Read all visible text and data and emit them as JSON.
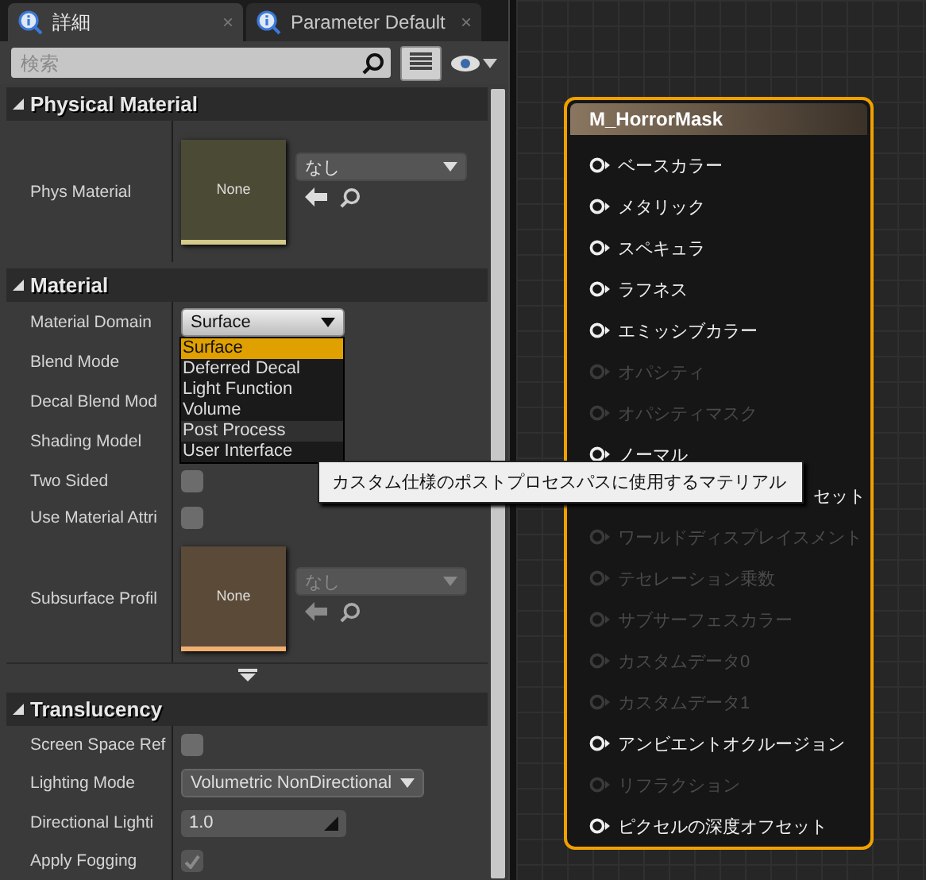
{
  "tabs": [
    {
      "label": "詳細",
      "selected": true,
      "close": "×"
    },
    {
      "label": "Parameter Default",
      "selected": false,
      "close": "×"
    }
  ],
  "search": {
    "placeholder": "検索"
  },
  "sections": [
    {
      "title": "Physical Material",
      "expanded": true,
      "rows": [
        {
          "kind": "asset",
          "label": "Phys Material",
          "thumbnail": "None",
          "value": "なし",
          "disabled": false
        }
      ]
    },
    {
      "title": "Material",
      "expanded": true,
      "rows": [
        {
          "kind": "dropdown",
          "label": "Material Domain",
          "value": "Surface",
          "open": true,
          "options": [
            {
              "label": "Surface",
              "selected": true,
              "hovered": false
            },
            {
              "label": "Deferred Decal",
              "selected": false,
              "hovered": false
            },
            {
              "label": "Light Function",
              "selected": false,
              "hovered": false
            },
            {
              "label": "Volume",
              "selected": false,
              "hovered": false
            },
            {
              "label": "Post Process",
              "selected": false,
              "hovered": true
            },
            {
              "label": "User Interface",
              "selected": false,
              "hovered": false
            }
          ]
        },
        {
          "kind": "empty",
          "label": "Blend Mode"
        },
        {
          "kind": "empty",
          "label": "Decal Blend Mod"
        },
        {
          "kind": "empty",
          "label": "Shading Model"
        },
        {
          "kind": "checkbox",
          "label": "Two Sided",
          "checked": false,
          "disabled": false
        },
        {
          "kind": "checkbox",
          "label": "Use Material Attri",
          "checked": false,
          "disabled": false
        },
        {
          "kind": "asset",
          "label": "Subsurface Profil",
          "thumbnail": "None",
          "value": "なし",
          "disabled": true
        }
      ],
      "more": true
    },
    {
      "title": "Translucency",
      "expanded": true,
      "rows": [
        {
          "kind": "checkbox",
          "label": "Screen Space Ref",
          "checked": false,
          "disabled": false
        },
        {
          "kind": "dropdown",
          "label": "Lighting Mode",
          "value": "Volumetric NonDirectional",
          "open": false
        },
        {
          "kind": "number",
          "label": "Directional Lighti",
          "value": "1.0"
        },
        {
          "kind": "checkbox",
          "label": "Apply Fogging",
          "checked": true,
          "disabled": true
        }
      ]
    }
  ],
  "tooltip": {
    "text": "カスタム仕様のポストプロセスパスに使用するマテリアル"
  },
  "node": {
    "title": "M_HorrorMask",
    "selected": true,
    "pins": [
      {
        "kind": "pin",
        "label": "ベースカラー",
        "enabled": true
      },
      {
        "kind": "pin",
        "label": "メタリック",
        "enabled": true
      },
      {
        "kind": "pin",
        "label": "スペキュラ",
        "enabled": true
      },
      {
        "kind": "pin",
        "label": "ラフネス",
        "enabled": true
      },
      {
        "kind": "pin",
        "label": "エミッシブカラー",
        "enabled": true
      },
      {
        "kind": "pin",
        "label": "オパシティ",
        "enabled": false
      },
      {
        "kind": "pin",
        "label": "オパシティマスク",
        "enabled": false
      },
      {
        "kind": "pin",
        "label": "ノーマル",
        "enabled": true
      },
      {
        "kind": "covered",
        "label": "セット",
        "enabled": true
      },
      {
        "kind": "pin",
        "label": "ワールドディスプレイスメント",
        "enabled": false
      },
      {
        "kind": "pin",
        "label": "テセレーション乗数",
        "enabled": false
      },
      {
        "kind": "pin",
        "label": "サブサーフェスカラー",
        "enabled": false
      },
      {
        "kind": "pin",
        "label": "カスタムデータ0",
        "enabled": false
      },
      {
        "kind": "pin",
        "label": "カスタムデータ1",
        "enabled": false
      },
      {
        "kind": "pin",
        "label": "アンビエントオクルージョン",
        "enabled": true
      },
      {
        "kind": "pin",
        "label": "リフラクション",
        "enabled": false
      },
      {
        "kind": "pin",
        "label": "ピクセルの深度オフセット",
        "enabled": true
      }
    ]
  }
}
